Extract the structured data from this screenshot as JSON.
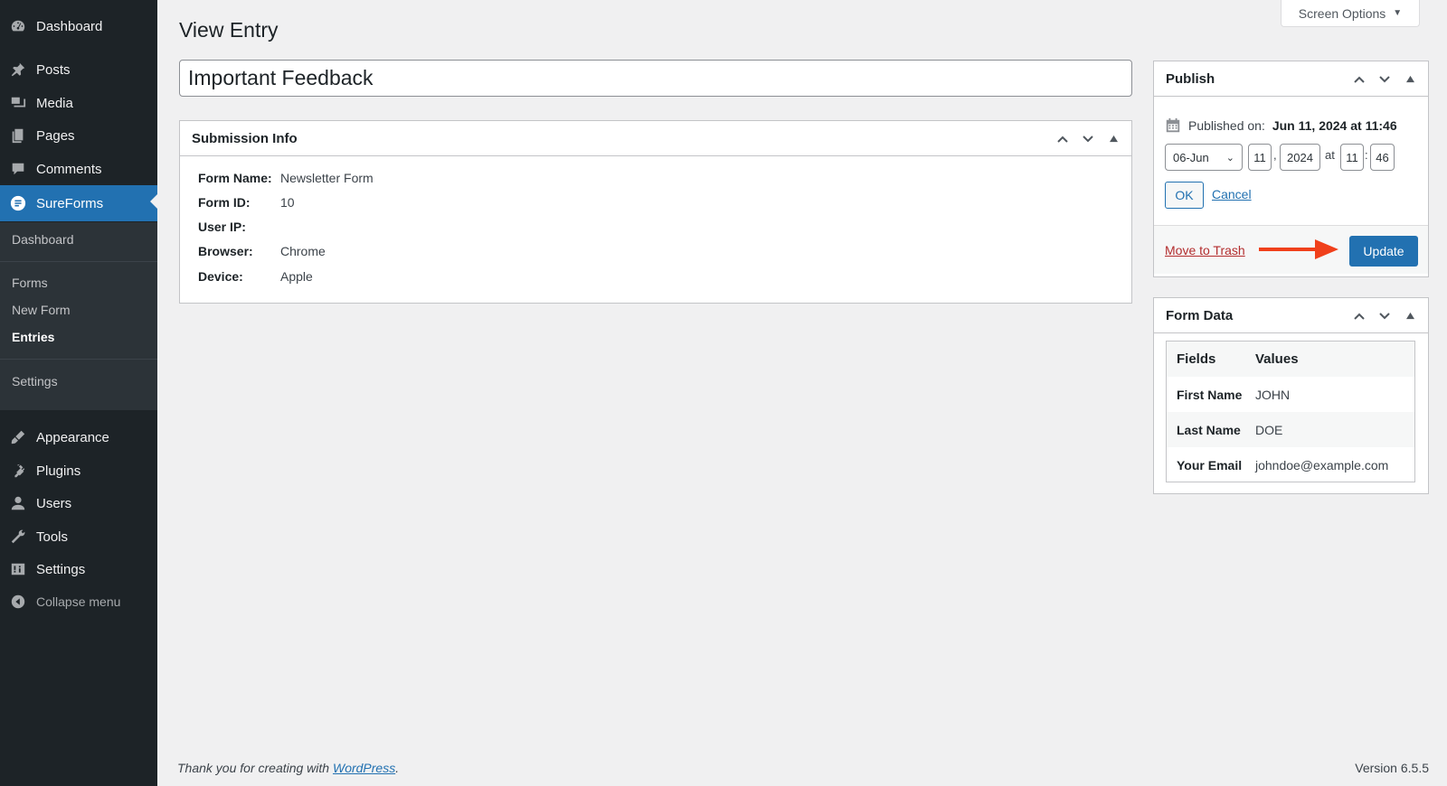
{
  "sidebar": {
    "items": [
      {
        "label": "Dashboard",
        "icon": "dashboard-icon"
      },
      {
        "label": "Posts",
        "icon": "pin-icon"
      },
      {
        "label": "Media",
        "icon": "media-icon"
      },
      {
        "label": "Pages",
        "icon": "pages-icon"
      },
      {
        "label": "Comments",
        "icon": "comment-icon"
      },
      {
        "label": "SureForms",
        "icon": "sureforms-icon"
      },
      {
        "label": "Appearance",
        "icon": "brush-icon"
      },
      {
        "label": "Plugins",
        "icon": "plugin-icon"
      },
      {
        "label": "Users",
        "icon": "user-icon"
      },
      {
        "label": "Tools",
        "icon": "wrench-icon"
      },
      {
        "label": "Settings",
        "icon": "settings-icon"
      }
    ],
    "submenu": [
      "Dashboard",
      "Forms",
      "New Form",
      "Entries",
      "Settings"
    ],
    "collapse_label": "Collapse menu"
  },
  "header": {
    "screen_options": "Screen Options",
    "page_title": "View Entry",
    "entry_title": "Important Feedback"
  },
  "submission_info": {
    "title": "Submission Info",
    "rows": [
      {
        "label": "Form Name:",
        "value": "Newsletter Form"
      },
      {
        "label": "Form ID:",
        "value": "10"
      },
      {
        "label": "User IP:",
        "value": ""
      },
      {
        "label": "Browser:",
        "value": "Chrome"
      },
      {
        "label": "Device:",
        "value": "Apple"
      }
    ]
  },
  "publish": {
    "title": "Publish",
    "published_label": "Published on:",
    "published_value": "Jun 11, 2024 at 11:46",
    "month": "06-Jun",
    "day": "11",
    "comma": ",",
    "year": "2024",
    "at": "at",
    "hour": "11",
    "colon": ":",
    "minute": "46",
    "ok_label": "OK",
    "cancel_label": "Cancel",
    "trash_label": "Move to Trash",
    "update_label": "Update"
  },
  "form_data": {
    "title": "Form Data",
    "headers": [
      "Fields",
      "Values"
    ],
    "rows": [
      {
        "field": "First Name",
        "value": "JOHN"
      },
      {
        "field": "Last Name",
        "value": "DOE"
      },
      {
        "field": "Your Email",
        "value": "johndoe@example.com"
      }
    ]
  },
  "footer": {
    "thanks_prefix": "Thank you for creating with ",
    "wp_link": "WordPress",
    "thanks_suffix": ".",
    "version": "Version 6.5.5"
  },
  "colors": {
    "sidebar_bg": "#1d2327",
    "accent": "#2271b1",
    "danger": "#b32d2e",
    "arrow": "#f0401b"
  }
}
